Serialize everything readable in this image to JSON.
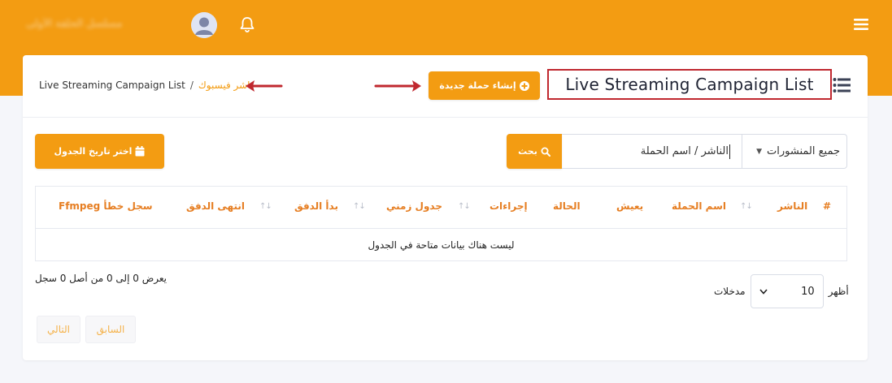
{
  "topbar": {
    "username": "مسلسل الحلقة الأولى"
  },
  "header": {
    "title": "Live Streaming Campaign List",
    "breadcrumb": {
      "current": "Live Streaming Campaign List",
      "separator": "/",
      "link": "ناشر فيسبوك"
    },
    "new_campaign_label": "إنشاء حملة جديدة"
  },
  "toolbar": {
    "date_button_label": "اختر تاريخ الجدول",
    "search_button_label": "بحث",
    "search_value": "الناشر / اسم الحملة",
    "posts_filter": "جميع المنشورات"
  },
  "table": {
    "columns": [
      "#",
      "الناشر",
      "اسم الحملة",
      "يعيش",
      "الحالة",
      "إجراءات",
      "جدول زمني",
      "بدأ الدفق",
      "انتهى الدفق",
      "سجل خطأ Ffmpeg"
    ],
    "sort_glyph": "↑↓",
    "empty_message": "ليست هناك بيانات متاحة في الجدول"
  },
  "footer": {
    "info": "يعرض 0 إلى 0 من أصل 0 سجل",
    "length_show": "أظهر",
    "length_value": "10",
    "length_entries": "مدخلات",
    "prev_label": "السابق",
    "next_label": "التالي"
  },
  "colors": {
    "brand": "#f39c12",
    "title_border": "#c0282f",
    "arrow": "#c0282f"
  }
}
